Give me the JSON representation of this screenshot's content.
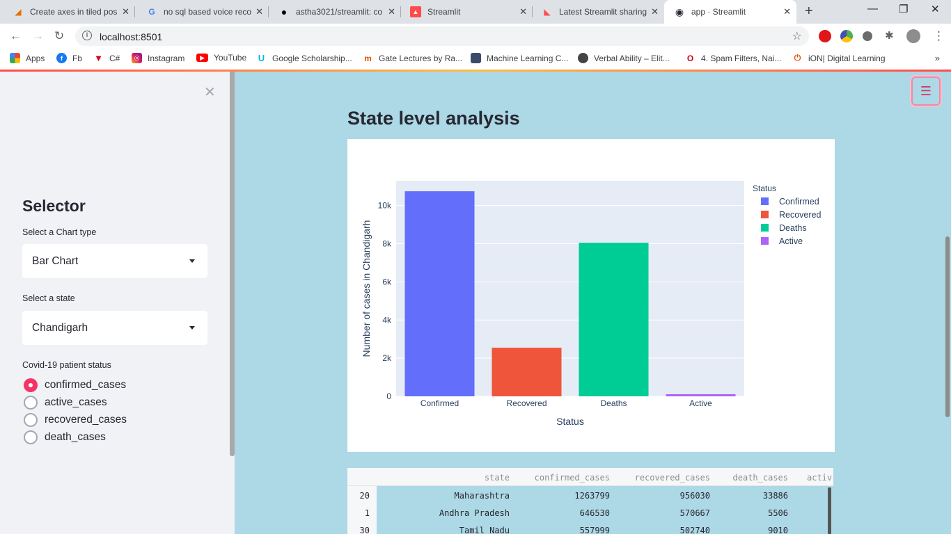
{
  "browser": {
    "tabs": [
      {
        "label": "Create axes in tiled pos",
        "icon": "matlab-icon",
        "active": false
      },
      {
        "label": "no sql based voice reco",
        "icon": "google-icon",
        "active": false
      },
      {
        "label": "astha3021/streamlit: co",
        "icon": "github-icon",
        "active": false
      },
      {
        "label": "Streamlit",
        "icon": "streamlit-icon",
        "active": false
      },
      {
        "label": "Latest Streamlit sharing",
        "icon": "streamlit-icon",
        "active": false
      },
      {
        "label": "app · Streamlit",
        "icon": "streamlit-app-icon",
        "active": true
      }
    ],
    "url": "localhost:8501",
    "bookmarks": [
      {
        "label": "Apps",
        "icon": "apps-grid-icon"
      },
      {
        "label": "Fb",
        "icon": "facebook-icon"
      },
      {
        "label": "C#",
        "icon": "bookmark-icon"
      },
      {
        "label": "Instagram",
        "icon": "instagram-icon"
      },
      {
        "label": "YouTube",
        "icon": "youtube-icon"
      },
      {
        "label": "Google Scholarship...",
        "icon": "udacity-icon"
      },
      {
        "label": "Gate Lectures by Ra...",
        "icon": "bookmark-icon"
      },
      {
        "label": "Machine Learning C...",
        "icon": "bookmark-icon"
      },
      {
        "label": "Verbal Ability – Elit...",
        "icon": "globe-icon"
      },
      {
        "label": "4. Spam Filters, Nai...",
        "icon": "bookmark-icon"
      },
      {
        "label": "iON| Digital Learning",
        "icon": "bookmark-icon"
      }
    ]
  },
  "sidebar": {
    "title": "Selector",
    "chart_type_label": "Select a Chart type",
    "chart_type_value": "Bar Chart",
    "state_label": "Select a state",
    "state_value": "Chandigarh",
    "status_label": "Covid-19 patient status",
    "status_options": [
      "confirmed_cases",
      "active_cases",
      "recovered_cases",
      "death_cases"
    ],
    "status_selected": "confirmed_cases"
  },
  "main": {
    "title": "State level analysis"
  },
  "chart_data": {
    "type": "bar",
    "categories": [
      "Confirmed",
      "Recovered",
      "Deaths",
      "Active"
    ],
    "values": [
      10750,
      2550,
      8050,
      110
    ],
    "colors": [
      "#636efa",
      "#ef553b",
      "#00cc96",
      "#ab63fa"
    ],
    "xlabel": "Status",
    "ylabel": "Number of cases in Chandigarh",
    "ylim": [
      0,
      11300
    ],
    "yticks": [
      0,
      2000,
      4000,
      6000,
      8000,
      10000
    ],
    "ytick_labels": [
      "0",
      "2k",
      "4k",
      "6k",
      "8k",
      "10k"
    ],
    "legend_title": "Status",
    "legend_placement": "right",
    "grid": true
  },
  "table": {
    "columns": [
      "state",
      "confirmed_cases",
      "recovered_cases",
      "death_cases",
      "activ"
    ],
    "rows": [
      {
        "index": "20",
        "cells": [
          "Maharashtra",
          "1263799",
          "956030",
          "33886",
          ""
        ]
      },
      {
        "index": "1",
        "cells": [
          "Andhra Pradesh",
          "646530",
          "570667",
          "5506",
          ""
        ]
      },
      {
        "index": "30",
        "cells": [
          "Tamil Nadu",
          "557999",
          "502740",
          "9010",
          ""
        ]
      }
    ]
  }
}
